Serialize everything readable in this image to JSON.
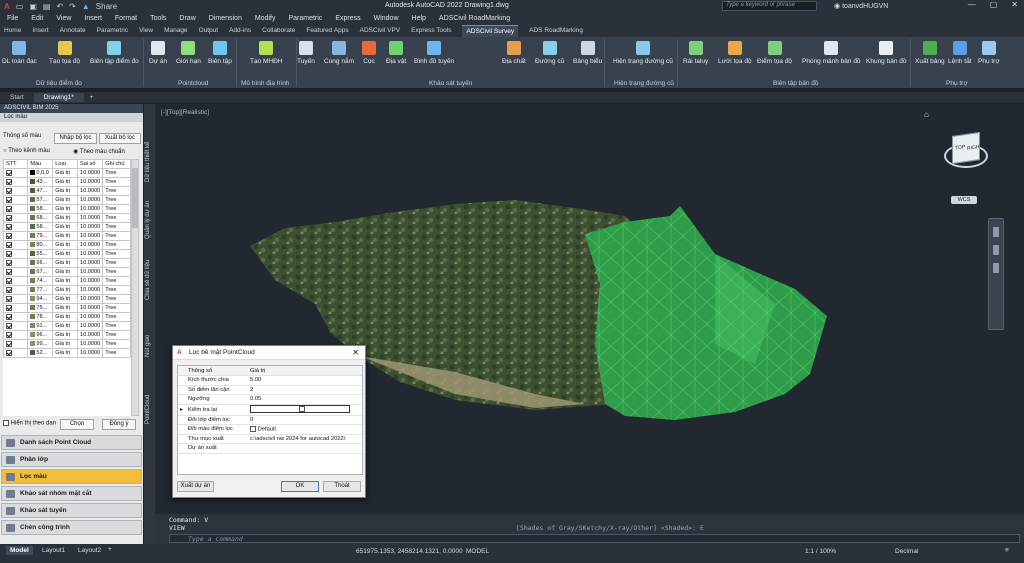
{
  "app": {
    "title": "Autodesk AutoCAD 2022   Drawing1.dwg",
    "share": "Share",
    "search_placeholder": "Type a keyword or phrase",
    "user": "toanvdHUGVN"
  },
  "menu": [
    "File",
    "Edit",
    "View",
    "Insert",
    "Format",
    "Tools",
    "Draw",
    "Dimension",
    "Modify",
    "Parametric",
    "Express",
    "Window",
    "Help",
    "ADSCivil RoadMarking"
  ],
  "ribbon_tabs": [
    "Home",
    "Insert",
    "Annotate",
    "Parametric",
    "View",
    "Manage",
    "Output",
    "Add-ins",
    "Collaborate",
    "Featured Apps",
    "ADSCivil VPV",
    "Express Tools",
    "ADSCivil Survey",
    "ADS RoadMarking"
  ],
  "ribbon_active": "ADSCivil Survey",
  "ribbon_buttons": [
    "DL toàn đạc",
    "Tạo tọa độ",
    "Biên tập điểm đo",
    "Dự án",
    "Giới hạn",
    "Biên tập",
    "Tạo MHĐH",
    "Tuyến",
    "Cong nắm",
    "Cọc",
    "Địa vật",
    "Bình đồ tuyến",
    "Địa chất",
    "Đường cũ",
    "Bảng biểu",
    "Hiện trạng đường cũ",
    "Rải taluy",
    "Lưới tọa độ",
    "Điểm tọa độ",
    "Phóng mảnh bản đồ",
    "Khung bản đồ",
    "Xuất bảng",
    "Lệnh tắt",
    "Phụ trợ"
  ],
  "ribbon_panels": [
    "Dữ liệu điểm đo",
    "Pointcloud",
    "Mô hình địa hình",
    "Khảo sát tuyến",
    "Hiện trạng đường cũ",
    "Biên tập bản đồ",
    "Phụ trợ"
  ],
  "doc_tabs": [
    "Start",
    "Drawing1*"
  ],
  "panel": {
    "title": "ADSCIVIL BIM 2025",
    "section": "Lọc màu",
    "sub": "Thông số màu",
    "import_btn": "Nhập bộ lọc",
    "export_btn": "Xuất bộ lọc",
    "radio1": "Theo kênh màu",
    "radio2": "Theo màu chuẩn",
    "columns": [
      "STT",
      "Màu",
      "Loại",
      "Sai số",
      "Ghi chú"
    ],
    "rows": [
      {
        "mau": "0,0,0",
        "loai": "Giá trị",
        "saiso": "10.0000",
        "ghichu": "Tree"
      },
      {
        "mau": "43...",
        "loai": "Giá trị",
        "saiso": "10.0000",
        "ghichu": "Tree"
      },
      {
        "mau": "47...",
        "loai": "Giá trị",
        "saiso": "10.0000",
        "ghichu": "Tree"
      },
      {
        "mau": "57...",
        "loai": "Giá trị",
        "saiso": "10.0000",
        "ghichu": "Tree"
      },
      {
        "mau": "58...",
        "loai": "Giá trị",
        "saiso": "10.0000",
        "ghichu": "Tree"
      },
      {
        "mau": "68...",
        "loai": "Giá trị",
        "saiso": "10.0000",
        "ghichu": "Tree"
      },
      {
        "mau": "58...",
        "loai": "Giá trị",
        "saiso": "10.0000",
        "ghichu": "Tree"
      },
      {
        "mau": "79...",
        "loai": "Giá trị",
        "saiso": "10.0000",
        "ghichu": "Tree"
      },
      {
        "mau": "80...",
        "loai": "Giá trị",
        "saiso": "10.0000",
        "ghichu": "Tree"
      },
      {
        "mau": "55...",
        "loai": "Giá trị",
        "saiso": "10.0000",
        "ghichu": "Tree"
      },
      {
        "mau": "66...",
        "loai": "Giá trị",
        "saiso": "10.0000",
        "ghichu": "Tree"
      },
      {
        "mau": "67...",
        "loai": "Giá trị",
        "saiso": "10.0000",
        "ghichu": "Tree"
      },
      {
        "mau": "74...",
        "loai": "Giá trị",
        "saiso": "10.0000",
        "ghichu": "Tree"
      },
      {
        "mau": "77...",
        "loai": "Giá trị",
        "saiso": "10.0000",
        "ghichu": "Tree"
      },
      {
        "mau": "94...",
        "loai": "Giá trị",
        "saiso": "10.0000",
        "ghichu": "Tree"
      },
      {
        "mau": "75...",
        "loai": "Giá trị",
        "saiso": "10.0000",
        "ghichu": "Tree"
      },
      {
        "mau": "78...",
        "loai": "Giá trị",
        "saiso": "10.0000",
        "ghichu": "Tree"
      },
      {
        "mau": "91...",
        "loai": "Giá trị",
        "saiso": "10.0000",
        "ghichu": "Tree"
      },
      {
        "mau": "96...",
        "loai": "Giá trị",
        "saiso": "10.0000",
        "ghichu": "Tree"
      },
      {
        "mau": "99...",
        "loai": "Giá trị",
        "saiso": "10.0000",
        "ghichu": "Tree"
      },
      {
        "mau": "52...",
        "loai": "Giá trị",
        "saiso": "10.0000",
        "ghichu": "Tree"
      }
    ],
    "swatches": [
      "#000000",
      "#3f5b34",
      "#456238",
      "#55703f",
      "#57704a",
      "#627a47",
      "#56704a",
      "#6f7f50",
      "#75864f",
      "#52683e",
      "#5f7a48",
      "#637a4b",
      "#6c8050",
      "#708156",
      "#848f63",
      "#6c7e52",
      "#718053",
      "#838c60",
      "#8a9463",
      "#8c9566",
      "#4b5f3c"
    ],
    "show_label": "Hiển thị theo dan",
    "chon_btn": "Chọn",
    "dongy_btn": "Đồng ý",
    "accordion": [
      "Danh sách Point Cloud",
      "Phân lớp",
      "Lọc màu",
      "Khảo sát nhóm mặt cắt",
      "Khảo sát tuyến",
      "Chèn công trình"
    ],
    "accordion_active": "Lọc màu",
    "vertical_tabs": [
      "Dữ liệu thiết kế",
      "Quản lý dự án",
      "Chia sẻ dữ liệu",
      "Nút giao",
      "PointCloud"
    ]
  },
  "viewport": {
    "label": "[-][Top][Realistic]",
    "cube_top": "TOP",
    "cube_right": "RIGHT",
    "wcs": "WCS"
  },
  "dialog": {
    "title": "Lọc bề mặt PointCloud",
    "col1": "Thông số",
    "col2": "Giá trị",
    "rows": [
      {
        "k": "Kích thước chia",
        "v": "5.00"
      },
      {
        "k": "Số điểm lân cận",
        "v": "2"
      },
      {
        "k": "Ngưỡng",
        "v": "0.05"
      },
      {
        "k": "Kiểm tra lại",
        "v": ""
      },
      {
        "k": "Đổi lớp điểm lọc",
        "v": "0"
      },
      {
        "k": "Đổi màu điểm lọc",
        "v": "Default"
      },
      {
        "k": "Thư mục xuất",
        "v": "c:\\adscivil nw 2024 for autocad 2022\\"
      },
      {
        "k": "Dự án xuất",
        "v": ""
      }
    ],
    "export_btn": "Xuất dự án",
    "ok_btn": "OK",
    "cancel_btn": "Thoát"
  },
  "command": {
    "history1": "Command: V",
    "history2": "VIEW",
    "history_tail": "[Shades of Gray/SKetchy/X-ray/Other] <Shaded>: E",
    "placeholder": "Type a command"
  },
  "status": {
    "tabs": [
      "Model",
      "Layout1",
      "Layout2"
    ],
    "coords": "651975.1353, 2458214.1321, 0.0000",
    "mode": "MODEL",
    "scale": "1:1 / 100%",
    "units": "Decimal"
  }
}
